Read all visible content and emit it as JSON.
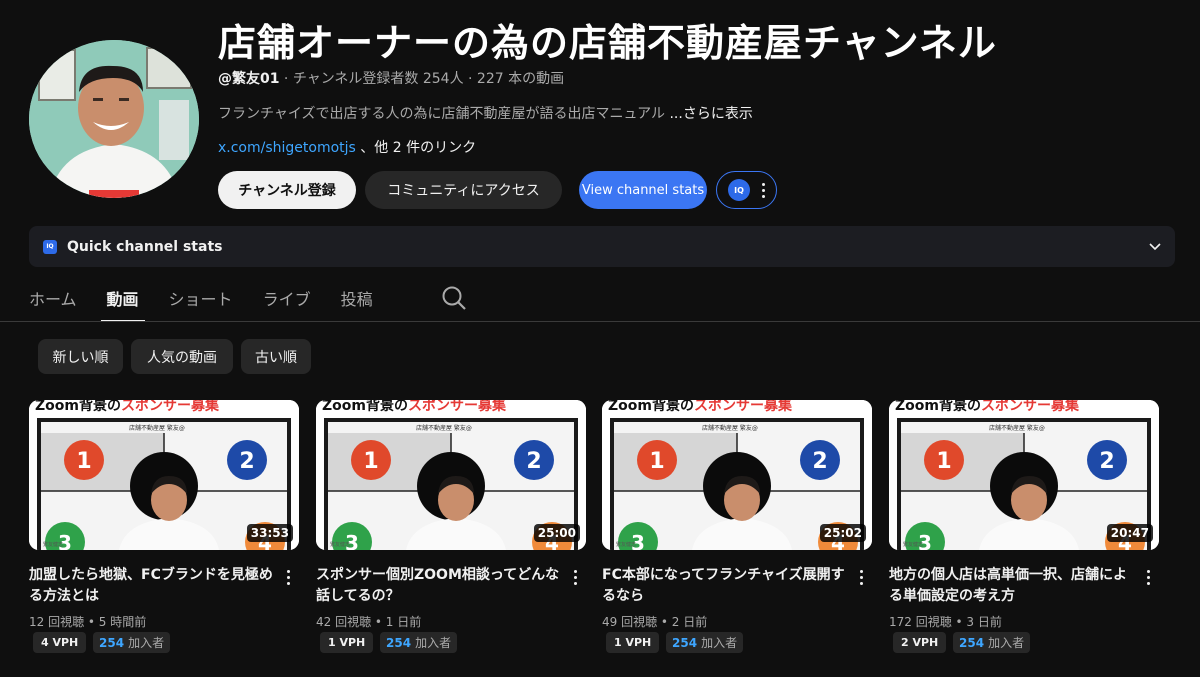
{
  "channel": {
    "title": "店舗オーナーの為の店舗不動産屋チャンネル",
    "handle": "@繁友01",
    "meta_rest": " · チャンネル登録者数 254人 · 227 本の動画",
    "description": "フランチャイズで出店する人の為に店舗不動産屋が語る出店マニュアル ",
    "more_label": "...さらに表示",
    "link_url": "x.com/shigetomotjs",
    "link_rest": " 、他 2 件のリンク"
  },
  "buttons": {
    "subscribe": "チャンネル登録",
    "community": "コミュニティにアクセス",
    "stats": "View channel stats",
    "iq_logo": "IQ"
  },
  "quick_stats": {
    "label": "Quick channel stats",
    "logo": "IQ"
  },
  "tabs": [
    "ホーム",
    "動画",
    "ショート",
    "ライブ",
    "投稿"
  ],
  "chips": [
    "新しい順",
    "人気の動画",
    "古い順"
  ],
  "thumbnail_text": {
    "banner_black": "Zoom背景の",
    "banner_red": "スポンサー募集",
    "header": "店舗不動産屋 繁友@",
    "num1": "1",
    "num2": "2",
    "num3": "3",
    "num4": "4"
  },
  "videos": [
    {
      "title": "加盟したら地獄、FCブランドを見極める方法とは",
      "meta": "12 回視聴 • 5 時間前",
      "duration": "33:53",
      "vph": "4 VPH",
      "subs_num": "254",
      "subs_label": "加入者"
    },
    {
      "title": "スポンサー個別ZOOM相談ってどんな話してるの？",
      "meta": "42 回視聴 • 1 日前",
      "duration": "25:00",
      "vph": "1 VPH",
      "subs_num": "254",
      "subs_label": "加入者"
    },
    {
      "title": "FC本部になってフランチャイズ展開するなら",
      "meta": "49 回視聴 • 2 日前",
      "duration": "25:02",
      "vph": "1 VPH",
      "subs_num": "254",
      "subs_label": "加入者"
    },
    {
      "title": "地方の個人店は高単価一択、店舗による単価設定の考え方",
      "meta": "172 回視聴 • 3 日前",
      "duration": "20:47",
      "vph": "2 VPH",
      "subs_num": "254",
      "subs_label": "加入者"
    }
  ],
  "colors": {
    "accent_blue": "#3b76f3",
    "link_blue": "#3ea6ff",
    "bg": "#0f0f0f"
  }
}
